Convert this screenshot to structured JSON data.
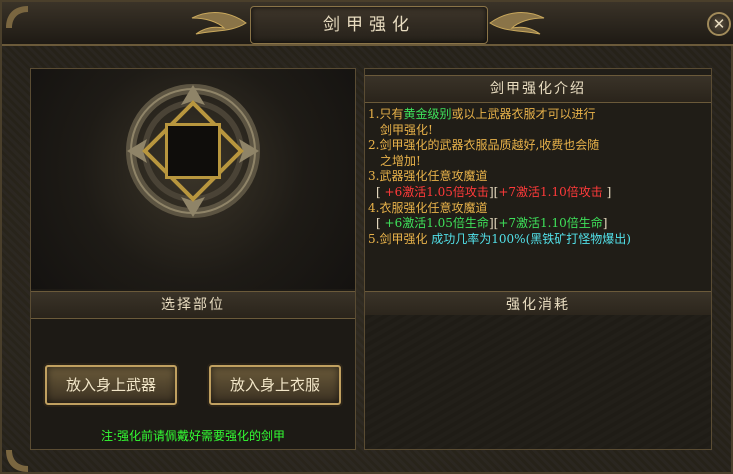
{
  "window": {
    "title": "剑甲强化",
    "close_symbol": "✕"
  },
  "left": {
    "slot_label": "",
    "section_header": "选择部位",
    "buttons": {
      "weapon": "放入身上武器",
      "armor": "放入身上衣服"
    },
    "note": "注:强化前请佩戴好需要强化的剑甲"
  },
  "right": {
    "intro_header": "剑甲强化介绍",
    "lines": {
      "l1a": "1.只有",
      "l1b": "黄金级别",
      "l1c": "或以上武器衣服才可以进行",
      "l1d": "剑甲强化!",
      "l2a": "2.剑甲强化的武器衣服品质越好,收费也会随",
      "l2b": "之增加!",
      "l3a": "3.武器强化任意攻魔道",
      "l3b_open": "[",
      "l3b_red1": "+6激活1.05倍攻击",
      "l3b_mid": "][",
      "l3b_red2": "+7激活1.10倍攻击",
      "l3b_close": "]",
      "l4a": "4.衣服强化任意攻魔道",
      "l4b_open": "[",
      "l4b_green1": "+6激活1.05倍生命",
      "l4b_mid": "][",
      "l4b_green2": "+7激活1.10倍生命",
      "l4b_close": "]",
      "l5a": "5.剑甲强化",
      "l5b": "成功几率为100%(黑铁矿打怪物爆出)"
    },
    "consume_header": "强化消耗"
  },
  "colors": {
    "gold_text": "#e8b24a",
    "red_text": "#ff3a3a",
    "green_text": "#3ee05a",
    "cyan_text": "#52e0e8",
    "note_text": "#33ff33",
    "frame_gold": "#b8963e"
  },
  "icons": {
    "close": "close-icon",
    "title_ornament": "winged-ornament-icon",
    "emblem": "circular-emblem-icon",
    "corner": "dragon-corner-icon"
  }
}
